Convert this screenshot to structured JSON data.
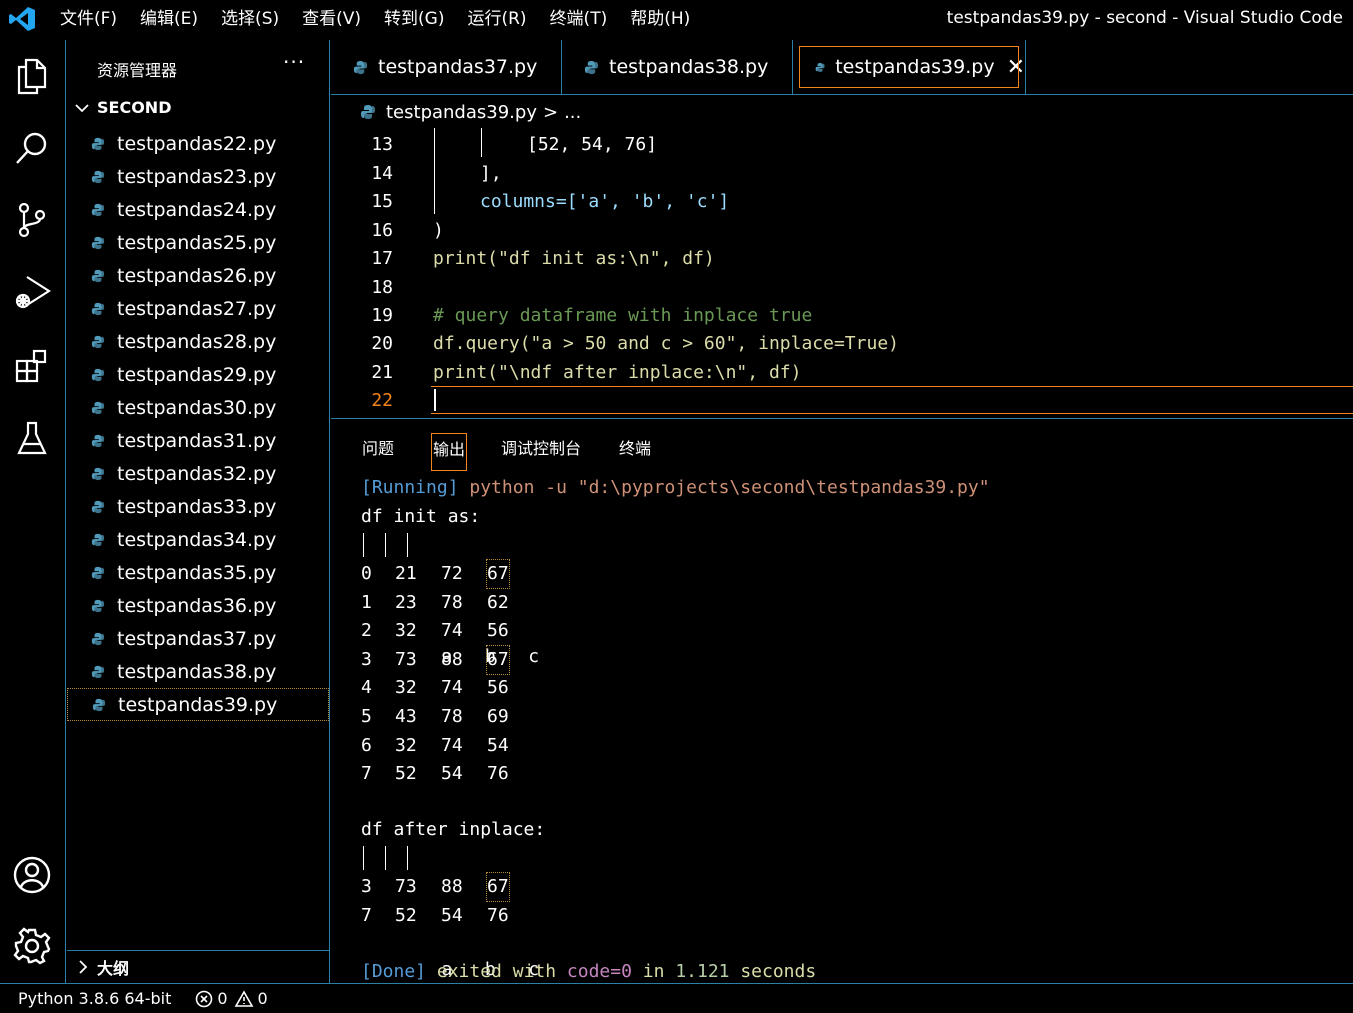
{
  "titlebar": {
    "menu": [
      "文件(F)",
      "编辑(E)",
      "选择(S)",
      "查看(V)",
      "转到(G)",
      "运行(R)",
      "终端(T)",
      "帮助(H)"
    ],
    "window_title": "testpandas39.py - second - Visual Studio Code"
  },
  "activity": [
    "explorer-icon",
    "search-icon",
    "source-control-icon",
    "run-debug-icon",
    "extensions-icon",
    "testing-icon",
    "account-icon",
    "settings-gear-icon"
  ],
  "sidebar": {
    "title": "资源管理器",
    "more": "···",
    "folder": "SECOND",
    "files": [
      "testpandas22.py",
      "testpandas23.py",
      "testpandas24.py",
      "testpandas25.py",
      "testpandas26.py",
      "testpandas27.py",
      "testpandas28.py",
      "testpandas29.py",
      "testpandas30.py",
      "testpandas31.py",
      "testpandas32.py",
      "testpandas33.py",
      "testpandas34.py",
      "testpandas35.py",
      "testpandas36.py",
      "testpandas37.py",
      "testpandas38.py",
      "testpandas39.py"
    ],
    "active_file": "testpandas39.py",
    "outline": "大纲"
  },
  "tabs": [
    {
      "label": "testpandas37.py"
    },
    {
      "label": "testpandas38.py"
    },
    {
      "label": "testpandas39.py",
      "active": true
    }
  ],
  "breadcrumb": {
    "file": "testpandas39.py",
    "sep": ">",
    "rest": "..."
  },
  "editor": {
    "line_numbers": [
      "13",
      "14",
      "15",
      "16",
      "17",
      "18",
      "19",
      "20",
      "21",
      "22"
    ],
    "current_line": "22",
    "lines": {
      "l13": "[52, 54, 76]",
      "l14": "],",
      "l15": "columns=['a', 'b', 'c']",
      "l16": ")",
      "l17": "print(\"df init as:\\n\", df)",
      "l19": "# query dataframe with inplace true",
      "l20": "df.query(\"a > 50 and c > 60\", inplace=True)",
      "l21": "print(\"\\ndf after inplace:\\n\", df)"
    }
  },
  "panel": {
    "tabs": [
      "问题",
      "输出",
      "调试控制台",
      "终端"
    ],
    "active_tab": "输出",
    "output": {
      "running_tag": "[Running]",
      "running_cmd": " python -u \"d:\\pyprojects\\second\\testpandas39.py\"",
      "init_title": "df init as:",
      "header": "   a   b   c",
      "init_rows": [
        [
          "0",
          "21",
          "72",
          "67"
        ],
        [
          "1",
          "23",
          "78",
          "62"
        ],
        [
          "2",
          "32",
          "74",
          "56"
        ],
        [
          "3",
          "73",
          "88",
          "67"
        ],
        [
          "4",
          "32",
          "74",
          "56"
        ],
        [
          "5",
          "43",
          "78",
          "69"
        ],
        [
          "6",
          "32",
          "74",
          "54"
        ],
        [
          "7",
          "52",
          "54",
          "76"
        ]
      ],
      "after_title": "df after inplace:",
      "after_rows": [
        [
          "3",
          "73",
          "88",
          "67"
        ],
        [
          "7",
          "52",
          "54",
          "76"
        ]
      ],
      "done_tag": "[Done]",
      "done_1": " exited with ",
      "done_code": "code=0",
      "done_2": " in ",
      "done_time": "1.121",
      "done_3": " seconds"
    }
  },
  "statusbar": {
    "python": "Python 3.8.6 64-bit",
    "errors": "0",
    "warnings": "0"
  },
  "colors": {
    "accent_border": "#2c7fa5",
    "focus": "#f38518",
    "vscode_blue": "#23a6f0"
  }
}
